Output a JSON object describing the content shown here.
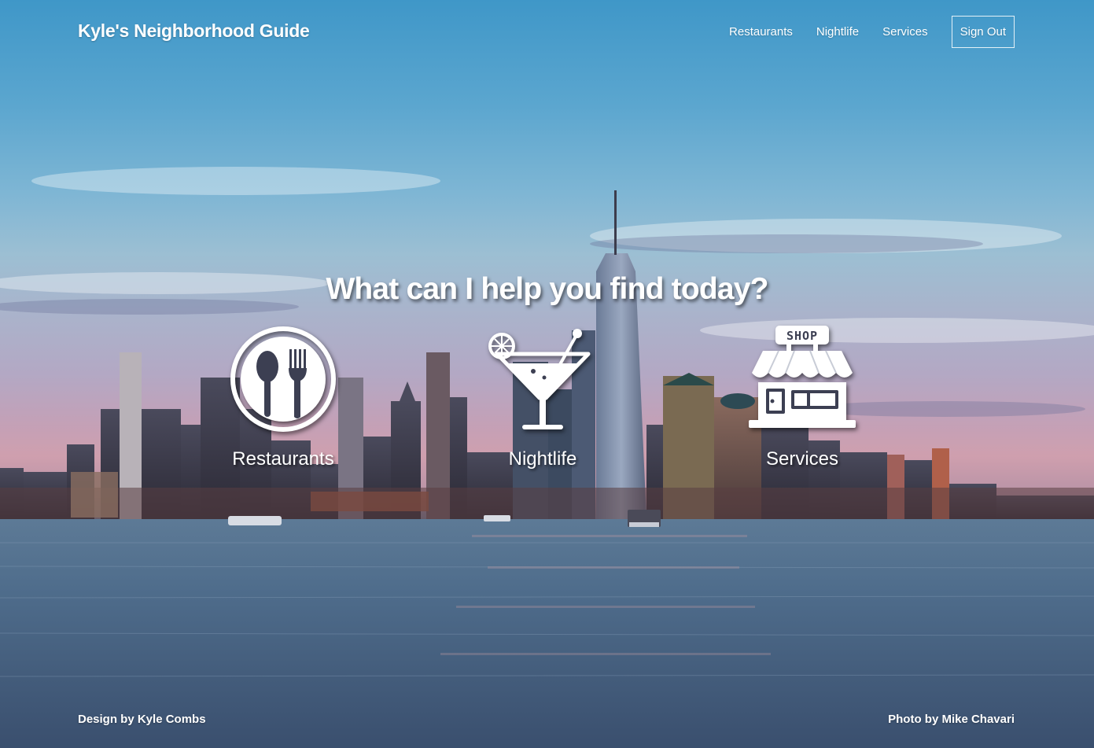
{
  "header": {
    "brand": "Kyle's Neighborhood Guide",
    "nav": {
      "restaurants": "Restaurants",
      "nightlife": "Nightlife",
      "services": "Services",
      "sign_out": "Sign Out"
    }
  },
  "hero": {
    "title": "What can I help you find today?",
    "categories": [
      {
        "label": "Restaurants",
        "icon": "restaurant-plate-icon"
      },
      {
        "label": "Nightlife",
        "icon": "cocktail-glass-icon"
      },
      {
        "label": "Services",
        "icon": "shop-storefront-icon",
        "sign_text": "SHOP"
      }
    ]
  },
  "footer": {
    "design_credit": "Design by Kyle Combs",
    "photo_credit": "Photo by Mike Chavari"
  },
  "colors": {
    "text": "#ffffff",
    "sky_top": "#3f97c8",
    "horizon_pink": "#cf9fae",
    "water": "#3e5877"
  }
}
